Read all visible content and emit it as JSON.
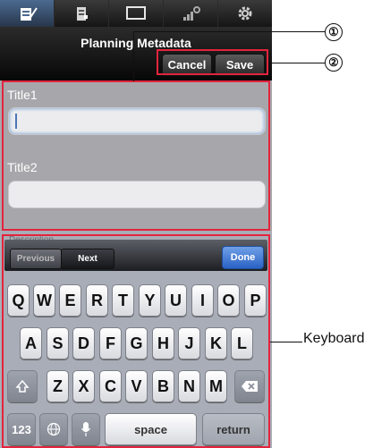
{
  "nav": {
    "title": "Planning Metadata",
    "cancel": "Cancel",
    "save": "Save"
  },
  "fields": {
    "title1_label": "Title1",
    "title2_label": "Title2",
    "description_label": "Description"
  },
  "accessory": {
    "previous": "Previous",
    "next": "Next",
    "done": "Done"
  },
  "keyboard": {
    "row1": [
      "Q",
      "W",
      "E",
      "R",
      "T",
      "Y",
      "U",
      "I",
      "O",
      "P"
    ],
    "row2": [
      "A",
      "S",
      "D",
      "F",
      "G",
      "H",
      "J",
      "K",
      "L"
    ],
    "row3": [
      "Z",
      "X",
      "C",
      "V",
      "B",
      "N",
      "M"
    ],
    "numbers": "123",
    "space": "space",
    "return": "return"
  },
  "callouts": {
    "one": "①",
    "two": "②",
    "keyboard_label": "Keyboard"
  },
  "colors": {
    "accent": "#e3243d",
    "active_tab": "#4b6a90"
  }
}
